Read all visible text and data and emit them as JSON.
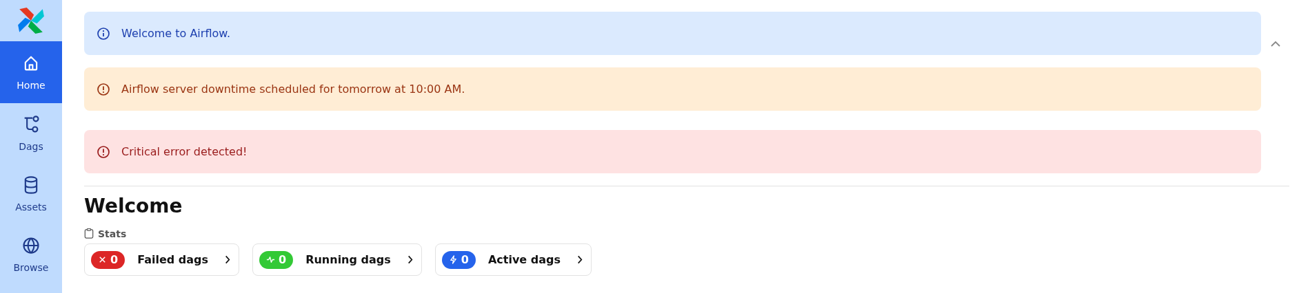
{
  "sidebar": {
    "items": [
      {
        "label": "Home",
        "kind": "home",
        "selected": true
      },
      {
        "label": "Dags",
        "kind": "dags",
        "selected": false
      },
      {
        "label": "Assets",
        "kind": "assets",
        "selected": false
      },
      {
        "label": "Browse",
        "kind": "browse",
        "selected": false
      }
    ]
  },
  "banners": [
    {
      "kind": "info",
      "text": "Welcome to Airflow."
    },
    {
      "kind": "warning",
      "text": "Airflow server downtime scheduled for tomorrow at 10:00 AM."
    },
    {
      "kind": "error",
      "text": "Critical error detected!"
    }
  ],
  "banners_expanded": true,
  "heading": "Welcome",
  "stats": {
    "label": "Stats",
    "cards": [
      {
        "kind": "failed",
        "count": "0",
        "label": "Failed dags",
        "color": "#dc2626"
      },
      {
        "kind": "running",
        "count": "0",
        "label": "Running dags",
        "color": "#33c936"
      },
      {
        "kind": "active",
        "count": "0",
        "label": "Active dags",
        "color": "#2563eb"
      }
    ]
  }
}
